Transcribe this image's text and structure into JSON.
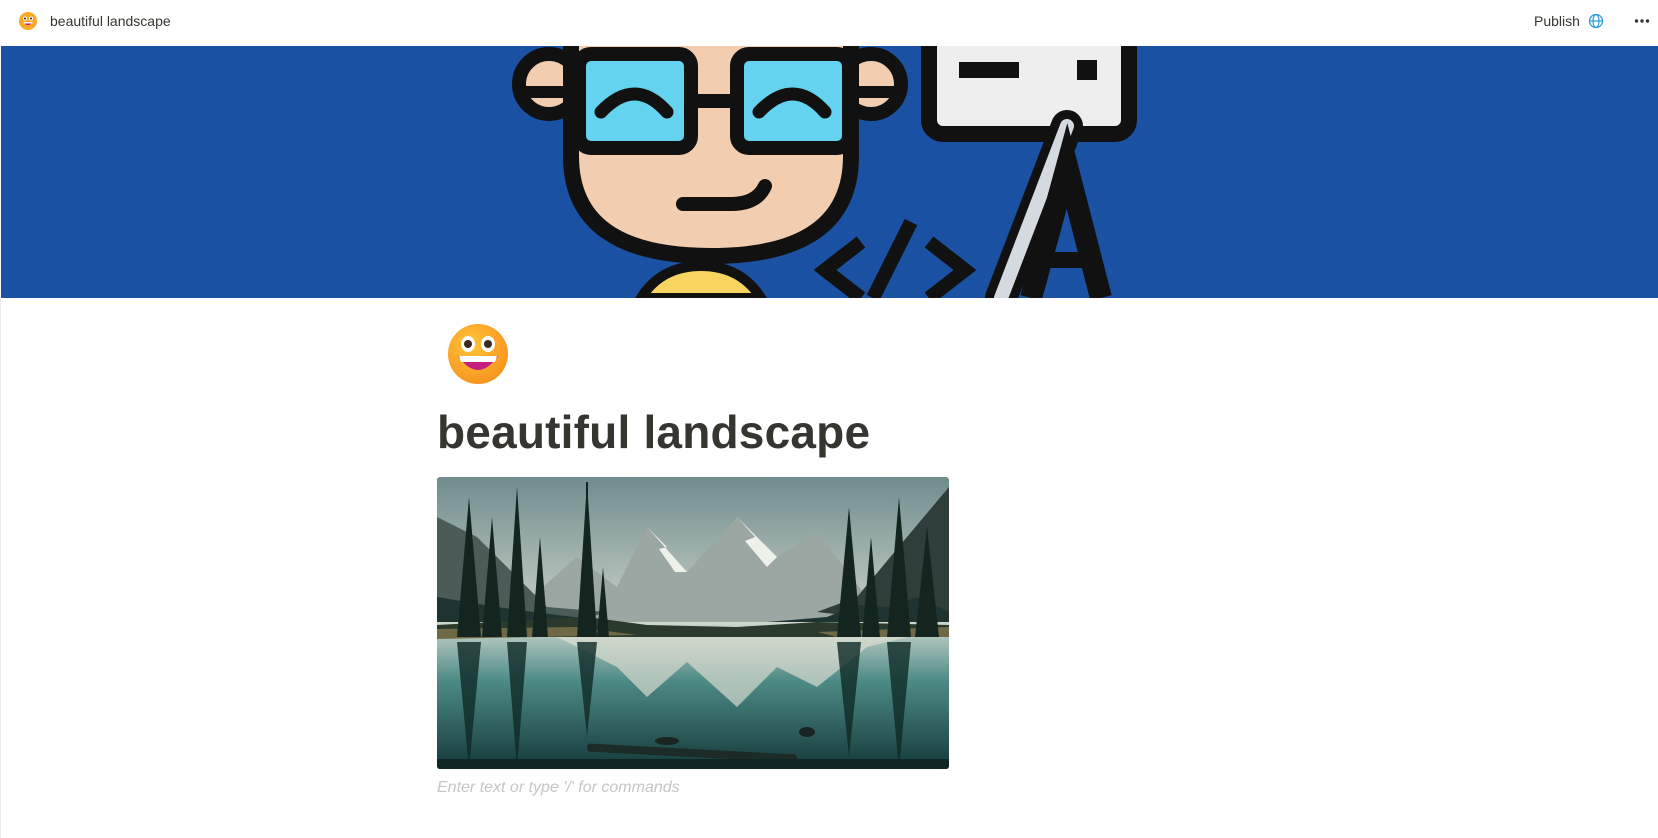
{
  "topbar": {
    "breadcrumb_icon": "grinning-face-icon",
    "breadcrumb_title": "beautiful landscape",
    "publish_label": "Publish",
    "publish_icon": "globe-icon",
    "more_icon": "ellipsis-icon"
  },
  "cover": {
    "description_icon": "developer-avatar-cover"
  },
  "page": {
    "icon": "grinning-face-icon",
    "title": "beautiful landscape",
    "image_block": {
      "subject": "mountain-lake-landscape"
    },
    "placeholder": "Enter text or type '/' for commands"
  },
  "colors": {
    "cover_bg": "#1a51a3",
    "text": "#37352f",
    "placeholder": "#c7c6c4",
    "accent": "#2383e2"
  }
}
